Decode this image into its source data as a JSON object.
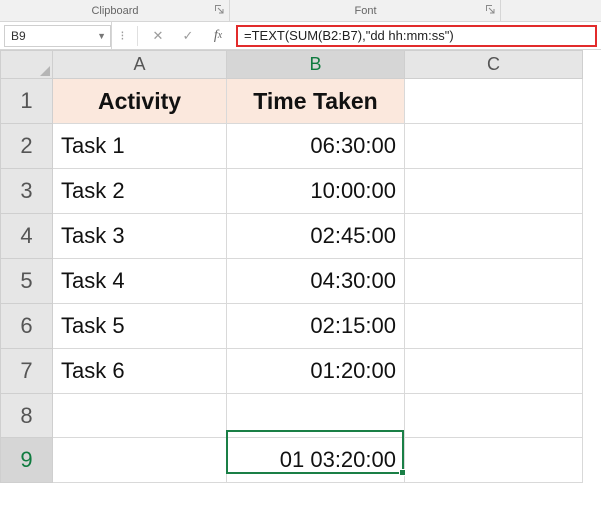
{
  "ribbon": {
    "groups": {
      "clipboard": "Clipboard",
      "font": "Font"
    }
  },
  "name_box": "B9",
  "formula_bar": "=TEXT(SUM(B2:B7),\"dd hh:mm:ss\")",
  "columns": [
    "A",
    "B",
    "C"
  ],
  "rows": [
    "1",
    "2",
    "3",
    "4",
    "5",
    "6",
    "7",
    "8",
    "9"
  ],
  "active_cell": {
    "col": "B",
    "row": 9
  },
  "chart_data": {
    "type": "table",
    "headers": {
      "A": "Activity",
      "B": "Time Taken"
    },
    "records": [
      {
        "activity": "Task 1",
        "time": "06:30:00"
      },
      {
        "activity": "Task 2",
        "time": "10:00:00"
      },
      {
        "activity": "Task 3",
        "time": "02:45:00"
      },
      {
        "activity": "Task 4",
        "time": "04:30:00"
      },
      {
        "activity": "Task 5",
        "time": "02:15:00"
      },
      {
        "activity": "Task 6",
        "time": "01:20:00"
      }
    ],
    "result_cell": {
      "row": 9,
      "col": "B",
      "value": "01 03:20:00"
    }
  }
}
